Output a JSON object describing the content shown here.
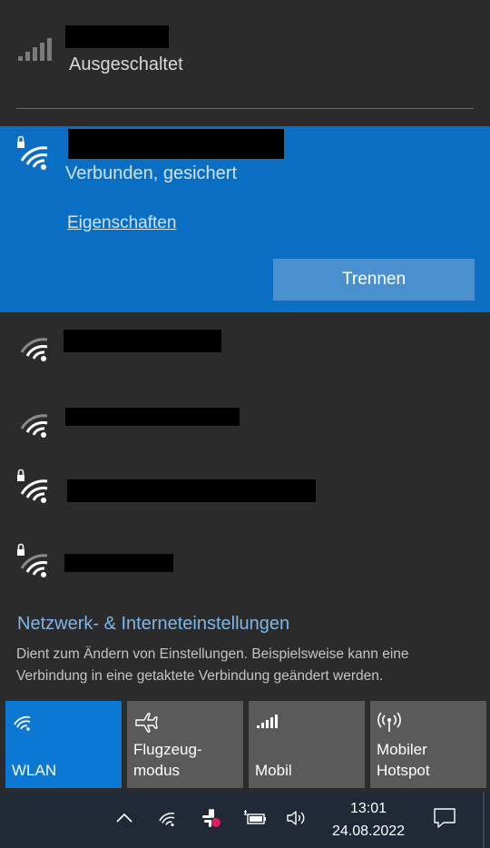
{
  "cellular": {
    "status": "Ausgeschaltet"
  },
  "connected_network": {
    "status": "Verbunden, gesichert",
    "properties_link": "Eigenschaften",
    "disconnect_label": "Trennen"
  },
  "settings": {
    "link": "Netzwerk- & Interneteinstellungen",
    "description": "Dient zum Ändern von Einstellungen. Beispielsweise kann eine Verbindung in eine getaktete Verbindung geändert werden."
  },
  "quick_actions": [
    {
      "label_line1": "",
      "label_line2": "WLAN",
      "icon": "wifi-icon",
      "active": true
    },
    {
      "label_line1": "Flugzeug-",
      "label_line2": "modus",
      "icon": "airplane-icon",
      "active": false
    },
    {
      "label_line1": "",
      "label_line2": "Mobil",
      "icon": "cellular-signal-icon",
      "active": false
    },
    {
      "label_line1": "Mobiler",
      "label_line2": "Hotspot",
      "icon": "hotspot-icon",
      "active": false
    }
  ],
  "taskbar": {
    "time": "13:01",
    "date": "24.08.2022"
  },
  "colors": {
    "accent": "#0b78d4",
    "selected_bg": "#0a6fc2",
    "flyout_bg": "#2b2b2b",
    "taskbar_bg": "#1f2a36",
    "link": "#7fb6e8"
  }
}
